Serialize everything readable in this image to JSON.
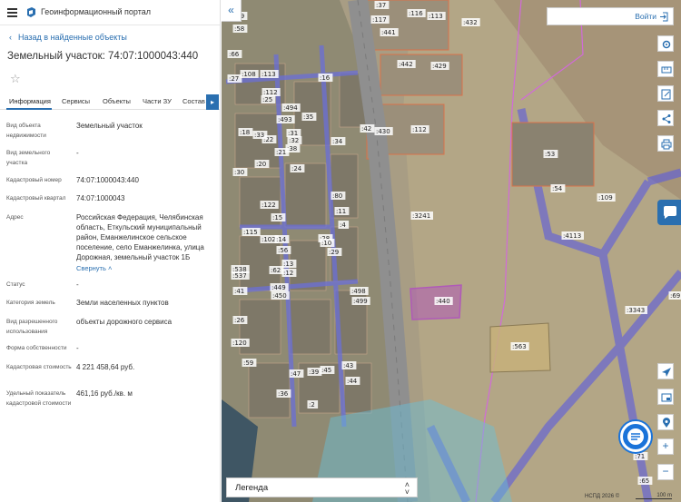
{
  "app": {
    "title": "Геоинформационный портал"
  },
  "panel": {
    "back_label": "Назад в найденные объекты",
    "object_title": "Земельный участок: 74:07:1000043:440",
    "favorite_icon": "star-icon",
    "tabs": [
      {
        "label": "Информация",
        "active": true
      },
      {
        "label": "Сервисы",
        "active": false
      },
      {
        "label": "Объекты",
        "active": false
      },
      {
        "label": "Части ЗУ",
        "active": false
      },
      {
        "label": "Состав",
        "active": false
      }
    ],
    "fields": [
      {
        "label": "Вид объекта недвижимости",
        "value": "Земельный участок"
      },
      {
        "label": "Вид земельного участка",
        "value": "-"
      },
      {
        "label": "Кадастровый номер",
        "value": "74:07:1000043:440"
      },
      {
        "label": "Кадастровый квартал",
        "value": "74:07:1000043"
      },
      {
        "label": "Адрес",
        "value": "Российская Федерация, Челябинская область, Еткульский муниципальный район, Еманжелинское сельское поселение, село Еманжелинка, улица Дорожная, земельный участок 1Б"
      },
      {
        "label": "Статус",
        "value": "-"
      },
      {
        "label": "Категория земель",
        "value": "Земли населенных пунктов"
      },
      {
        "label": "Вид разрешенного использования",
        "value": "объекты дорожного сервиса"
      },
      {
        "label": "Форма собственности",
        "value": "-"
      },
      {
        "label": "Кадастровая стоимость",
        "value": "4 221 458,64 руб."
      },
      {
        "label": "Удельный показатель кадастровой стоимости",
        "value": "461,16 руб./кв. м"
      }
    ],
    "collapse_label": "Свернуть"
  },
  "map": {
    "login_label": "Войти",
    "legend_label": "Легенда",
    "copyright": "НСПД 2026 ©",
    "scale_label": "100 m",
    "colors": {
      "accent": "#2a6fb0",
      "selected_parcel": "#b05ab8",
      "parcel_border": "#d9724a",
      "zone_blue": "#5a5ae0",
      "road": "#8f8f8f"
    },
    "parcel_labels": [
      {
        "text": ":440",
        "selected": true
      },
      {
        "text": ":563"
      },
      {
        "text": ":3241"
      },
      {
        "text": ":4113"
      },
      {
        "text": ":3343"
      },
      {
        "text": ":109"
      },
      {
        "text": ":112"
      },
      {
        "text": ":430"
      },
      {
        "text": ":442"
      },
      {
        "text": ":429"
      },
      {
        "text": ":432"
      },
      {
        "text": ":441"
      },
      {
        "text": ":116"
      },
      {
        "text": ":113"
      },
      {
        "text": ":117"
      },
      {
        "text": ":37"
      },
      {
        "text": ":53"
      },
      {
        "text": ":54"
      },
      {
        "text": ":69"
      },
      {
        "text": ":71"
      },
      {
        "text": ":65"
      },
      {
        "text": ":498"
      },
      {
        "text": ":499"
      },
      {
        "text": ":494"
      },
      {
        "text": ":493"
      },
      {
        "text": ":108"
      },
      {
        "text": ":113"
      },
      {
        "text": ":112"
      },
      {
        "text": ":25"
      },
      {
        "text": ":27"
      },
      {
        "text": ":16"
      },
      {
        "text": ":35"
      },
      {
        "text": ":42"
      },
      {
        "text": ":34"
      },
      {
        "text": ":18"
      },
      {
        "text": ":22"
      },
      {
        "text": ":31"
      },
      {
        "text": ":32"
      },
      {
        "text": ":38"
      },
      {
        "text": ":21"
      },
      {
        "text": ":20"
      },
      {
        "text": ":33"
      },
      {
        "text": ":30"
      },
      {
        "text": ":24"
      },
      {
        "text": ":122"
      },
      {
        "text": ":115"
      },
      {
        "text": ":102"
      },
      {
        "text": ":14"
      },
      {
        "text": ":15"
      },
      {
        "text": ":56"
      },
      {
        "text": ":538"
      },
      {
        "text": ":537"
      },
      {
        "text": ":62"
      },
      {
        "text": ":13"
      },
      {
        "text": ":12"
      },
      {
        "text": ":41"
      },
      {
        "text": ":449"
      },
      {
        "text": ":450"
      },
      {
        "text": ":26"
      },
      {
        "text": ":120"
      },
      {
        "text": ":59"
      },
      {
        "text": ":47"
      },
      {
        "text": ":36"
      },
      {
        "text": ":39"
      },
      {
        "text": ":45"
      },
      {
        "text": ":43"
      },
      {
        "text": ":44"
      },
      {
        "text": ":29"
      },
      {
        "text": ":28"
      },
      {
        "text": ":80"
      },
      {
        "text": ":11"
      },
      {
        "text": ":10"
      },
      {
        "text": ":66"
      },
      {
        "text": ":59"
      },
      {
        "text": ":58"
      },
      {
        "text": ":4"
      },
      {
        "text": ":2"
      }
    ]
  }
}
